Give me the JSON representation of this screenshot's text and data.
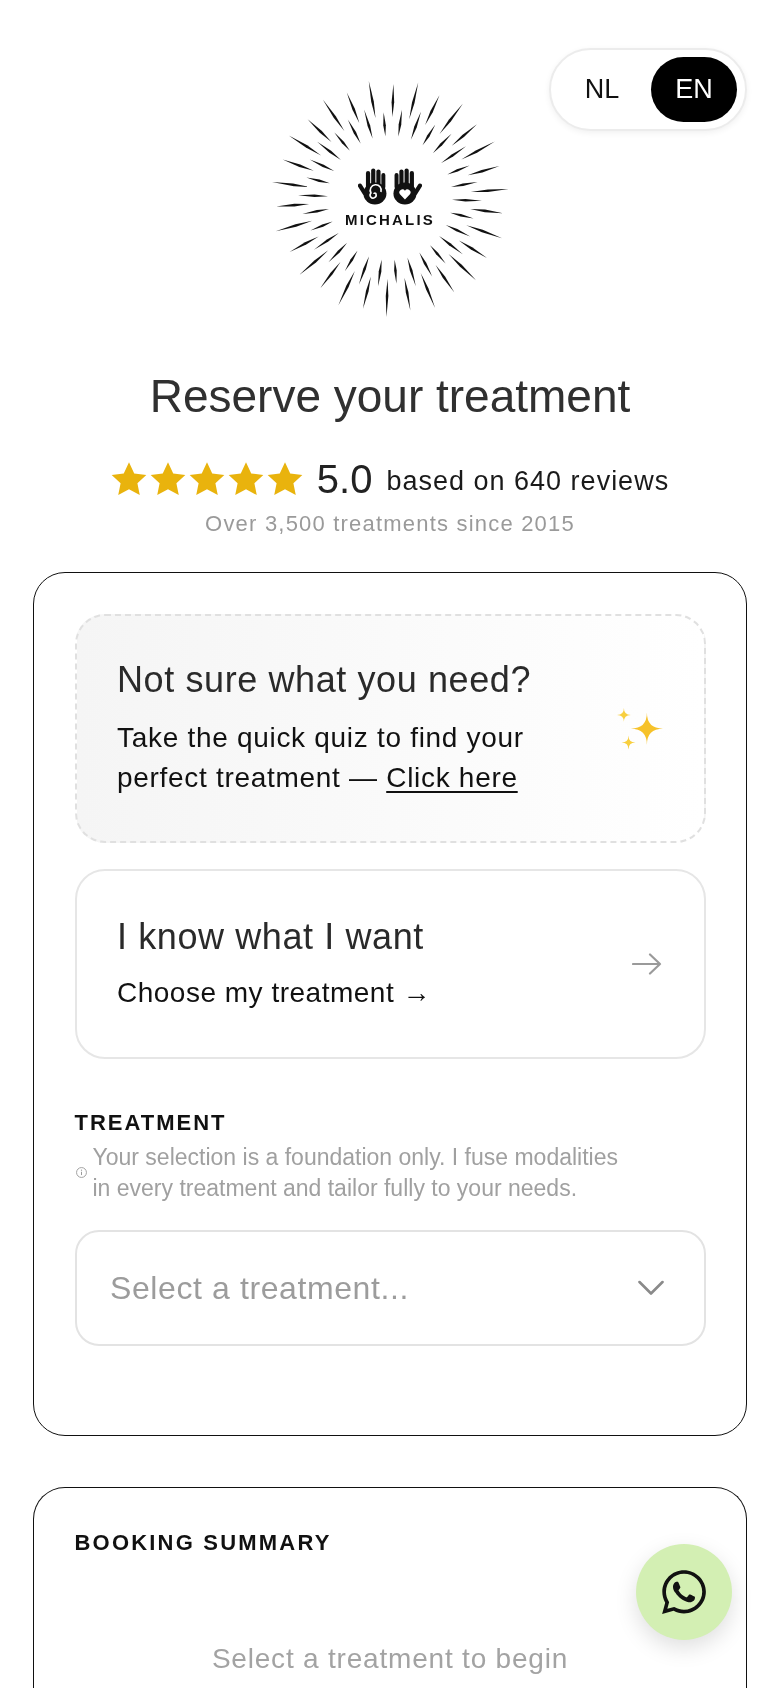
{
  "languages": [
    {
      "label": "NL",
      "selected": false
    },
    {
      "label": "EN",
      "selected": true
    }
  ],
  "logo": {
    "text": "MICHALIS"
  },
  "title": "Reserve your treatment",
  "rating": {
    "stars": 5,
    "score": "5.0",
    "summary": "based on 640 reviews"
  },
  "tagline": "Over 3,500 treatments since 2015",
  "quiz_card": {
    "title": "Not sure what you need?",
    "text": "Take the quick quiz to find your perfect treatment —",
    "link": "Click here"
  },
  "choice_card": {
    "title": "I know what I want",
    "link": "Choose my treatment →"
  },
  "treatment_field": {
    "label": "TREATMENT",
    "hint": "Your selection is a foundation only. I fuse modalities in every treatment and tailor fully to your needs.",
    "placeholder": "Select a treatment..."
  },
  "booking_summary": {
    "title": "BOOKING SUMMARY",
    "empty_message": "Select a treatment to begin"
  }
}
